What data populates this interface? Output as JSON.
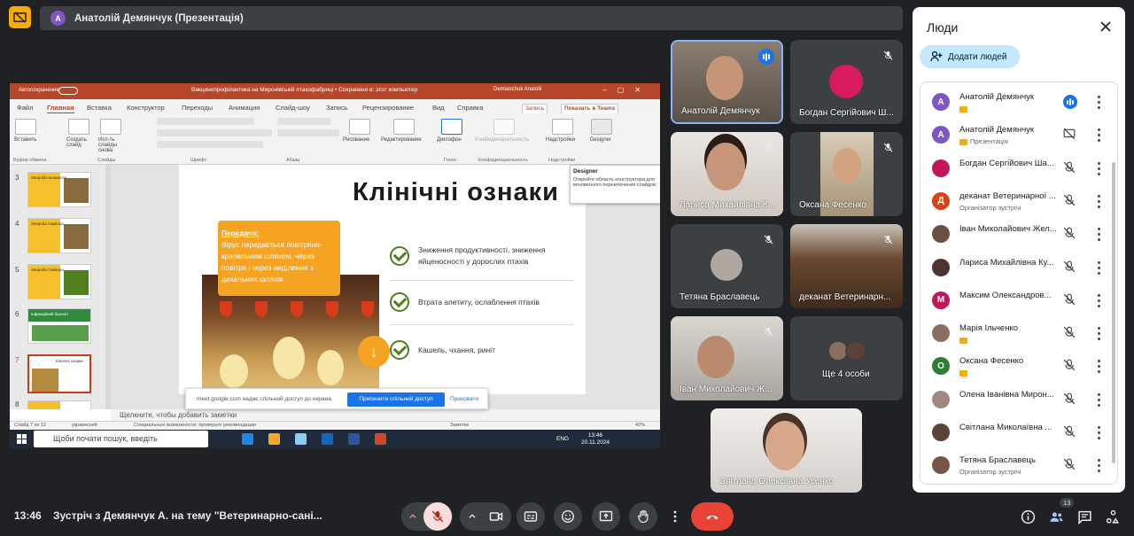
{
  "header": {
    "presenter_initial": "A",
    "presenter_label": "Анатолій Демянчук (Презентація)"
  },
  "powerpoint": {
    "autosave": "Автосохранение",
    "window_title": "Вакцинопрофілактика на Миронівській птахофабриці • Сохранено в: этот компьютер",
    "user": "Demianchuk Anatolii",
    "tabs": [
      "Файл",
      "Главная",
      "Вставка",
      "Конструктор",
      "Переходы",
      "Анимация",
      "Слайд-шоу",
      "Запись",
      "Рецензирование",
      "Вид",
      "Справка"
    ],
    "record_button": "Запись",
    "teams_button": "Показать в Teams",
    "ribbon": {
      "paste": "Вставить",
      "create_slide": "Создать слайд",
      "reuse_slides": "Исп-ть слайды снова",
      "drawing": "Рисование",
      "editing": "Редактирование",
      "dictation": "Диктофон",
      "privacy": "Конфиденциальность",
      "addins": "Надстройки",
      "designer": "Designer",
      "groups": [
        "Буфер обмена",
        "Слайды",
        "Шрифт",
        "Абзац",
        "Голос",
        "Конфиденциальность",
        "Надстройки"
      ]
    },
    "tooltip": {
      "title": "Designer",
      "text": "Откройте область конструктора для мгновенного переключения слайдов."
    },
    "thumbnails": [
      {
        "num": "3",
        "title": "Хвороба Ньюкасла"
      },
      {
        "num": "4",
        "title": "Хвороба Гамборо"
      },
      {
        "num": "5",
        "title": "Хвороба Гамборо"
      },
      {
        "num": "6",
        "title": "Інфекційний бронхіт"
      },
      {
        "num": "7",
        "title": "Клінічні ознаки"
      },
      {
        "num": "8",
        "title": ""
      }
    ],
    "slide": {
      "title": "Клінічні ознаки",
      "box_heading": "Передача:",
      "box_text": "Вірус передається повітряно-крапельним шляхом, через повітря і через виділення з дихальних шляхів",
      "bullets": [
        "Зниження продуктивності, зниження яйценосності у дорослих птахів",
        "Втрата апетиту, ослаблення птахів",
        "Кашель, чхання, риніт"
      ]
    },
    "notes_placeholder": "Щелкните, чтобы добавить заметки",
    "status": {
      "slide_info": "Слайд 7 из 12",
      "language": "украинский",
      "accessibility": "Специальные возможности: проверьте рекомендации",
      "notes": "Заметки",
      "zoom": "42%"
    },
    "sharing_bar": {
      "message": "meet.google.com надає спільний доступ до екрана.",
      "stop": "Припинити спільний доступ",
      "hide": "Приховати"
    },
    "taskbar": {
      "search": "Щоби почати пошук, введіть",
      "lang": "ENG",
      "time": "13:46",
      "date": "20.11.2024"
    }
  },
  "tiles": [
    {
      "name": "Анатолій Демянчук",
      "speaking": true
    },
    {
      "name": "Богдан Сергійович Ш...",
      "speaking": false
    },
    {
      "name": "Лариса Михайлівна К...",
      "speaking": false
    },
    {
      "name": "Оксана Фесенко",
      "speaking": false
    },
    {
      "name": "Тетяна Браславець",
      "speaking": false
    },
    {
      "name": "деканат Ветеринарн...",
      "speaking": false
    },
    {
      "name": "Іван Миколайович Ж...",
      "speaking": false
    },
    {
      "name": "Ще 4 особи",
      "speaking": false
    },
    {
      "name": "Світлана Олексіївна Усенко",
      "speaking": false
    }
  ],
  "people_panel": {
    "title": "Люди",
    "add_button": "Додати людей",
    "participants": [
      {
        "initial": "А",
        "name": "Анатолій Демянчук",
        "sub": "",
        "badge": true,
        "color": "#7e57c2",
        "speaking": true
      },
      {
        "initial": "А",
        "name": "Анатолій Демянчук",
        "sub": "Презентація",
        "badge": true,
        "color": "#7e57c2",
        "speaking": false
      },
      {
        "initial": "",
        "name": "Богдан Сергійович Ша...",
        "sub": "",
        "badge": false,
        "color": "#c2185b",
        "speaking": false
      },
      {
        "initial": "Д",
        "name": "деканат Ветеринарної ...",
        "sub": "Організатор зустрічі",
        "badge": false,
        "color": "#d84315",
        "speaking": false
      },
      {
        "initial": "",
        "name": "Іван Миколайович Жел...",
        "sub": "",
        "badge": false,
        "color": "#6d4c41",
        "speaking": false
      },
      {
        "initial": "",
        "name": "Лариса Михайлівна Ку...",
        "sub": "",
        "badge": false,
        "color": "#4e342e",
        "speaking": false
      },
      {
        "initial": "М",
        "name": "Максим Олександров...",
        "sub": "",
        "badge": false,
        "color": "#c2185b",
        "speaking": false
      },
      {
        "initial": "",
        "name": "Марія Ільченко",
        "sub": "",
        "badge": true,
        "color": "#8d6e63",
        "speaking": false
      },
      {
        "initial": "О",
        "name": "Оксана Фесенко",
        "sub": "",
        "badge": true,
        "color": "#2e7d32",
        "speaking": false
      },
      {
        "initial": "",
        "name": "Олена Іванівна Мирон...",
        "sub": "",
        "badge": false,
        "color": "#a1887f",
        "speaking": false
      },
      {
        "initial": "",
        "name": "Світлана Миколаївна ...",
        "sub": "",
        "badge": false,
        "color": "#5d4037",
        "speaking": false
      },
      {
        "initial": "",
        "name": "Тетяна Браславець",
        "sub": "Організатор зустрічі",
        "badge": false,
        "color": "#795548",
        "speaking": false
      }
    ]
  },
  "bottom_bar": {
    "time": "13:46",
    "meeting_title": "Зустріч з Демянчук А. на тему \"Ветеринарно-сані...",
    "people_count": "13"
  }
}
